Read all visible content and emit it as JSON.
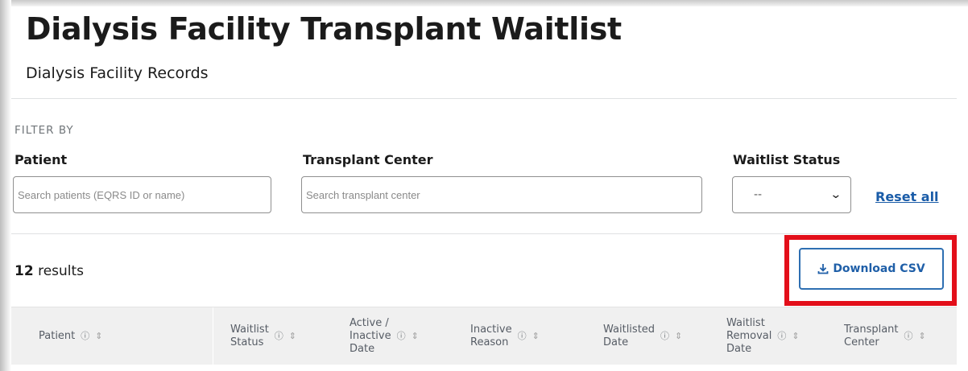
{
  "header": {
    "title": "Dialysis Facility Transplant Waitlist",
    "subtitle": "Dialysis Facility Records"
  },
  "filters": {
    "section_label": "FILTER BY",
    "patient": {
      "label": "Patient",
      "placeholder": "Search patients (EQRS ID or name)"
    },
    "transplant_center": {
      "label": "Transplant Center",
      "placeholder": "Search transplant center"
    },
    "waitlist_status": {
      "label": "Waitlist Status",
      "selected": "--"
    },
    "reset_label": "Reset all"
  },
  "results": {
    "count": "12",
    "suffix": "results"
  },
  "download_button": {
    "label": "Download CSV",
    "icon": "download-icon"
  },
  "highlight_color": "#e30f1a",
  "table": {
    "columns": [
      {
        "label": "Patient"
      },
      {
        "label": "Waitlist\nStatus"
      },
      {
        "label": "Active /\nInactive\nDate"
      },
      {
        "label": "Inactive\nReason"
      },
      {
        "label": "Waitlisted\nDate"
      },
      {
        "label": "Waitlist\nRemoval\nDate"
      },
      {
        "label": "Transplant\nCenter"
      }
    ],
    "info_glyph": "ⓘ",
    "sort_glyph": "⇕"
  }
}
